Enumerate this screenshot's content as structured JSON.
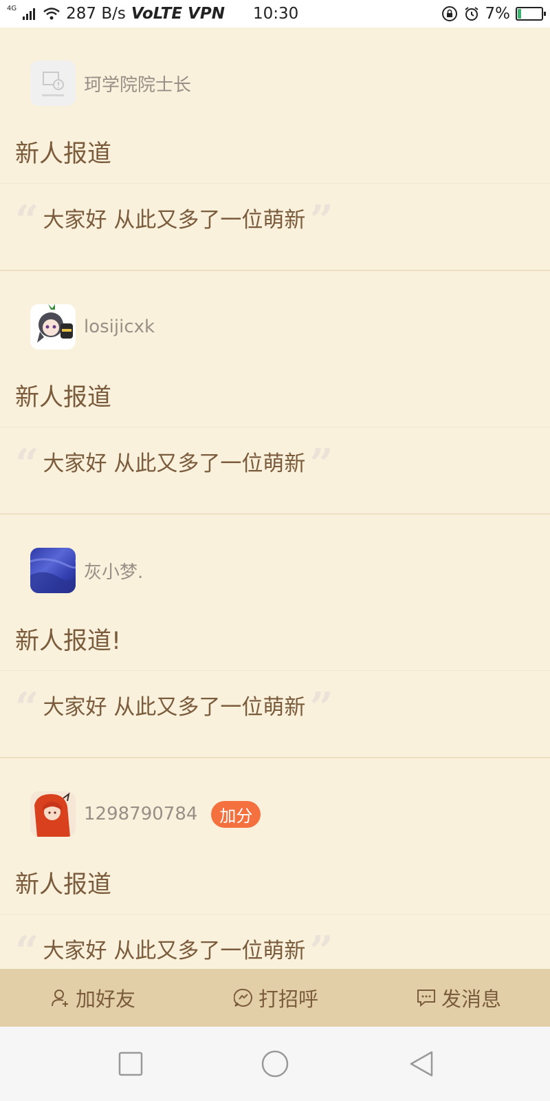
{
  "status_bar": {
    "network_tag": "4G",
    "speed": "287 B/s",
    "volte": "VoLTE",
    "vpn": "VPN",
    "time": "10:30",
    "battery": "7%"
  },
  "posts": [
    {
      "author": "珂学院院士长",
      "avatar": "placeholder-image",
      "title": "新人报道",
      "quote": "大家好 从此又多了一位萌新",
      "badge": ""
    },
    {
      "author": "losijicxk",
      "avatar": "anime-avatar",
      "title": "新人报道",
      "quote": "大家好 从此又多了一位萌新",
      "badge": ""
    },
    {
      "author": "灰小梦.",
      "avatar": "blue-avatar",
      "title": "新人报道!",
      "quote": "大家好 从此又多了一位萌新",
      "badge": ""
    },
    {
      "author": "1298790784",
      "avatar": "red-hair-avatar",
      "title": "新人报道",
      "quote": "大家好 从此又多了一位萌新",
      "badge": "加分"
    }
  ],
  "actions": {
    "add_friend": "加好友",
    "greet": "打招呼",
    "message": "发消息"
  },
  "colors": {
    "background": "#faf1dd",
    "action_bar": "#e3cfa7",
    "text": "#7a5c3d",
    "badge": "#f4703f"
  }
}
